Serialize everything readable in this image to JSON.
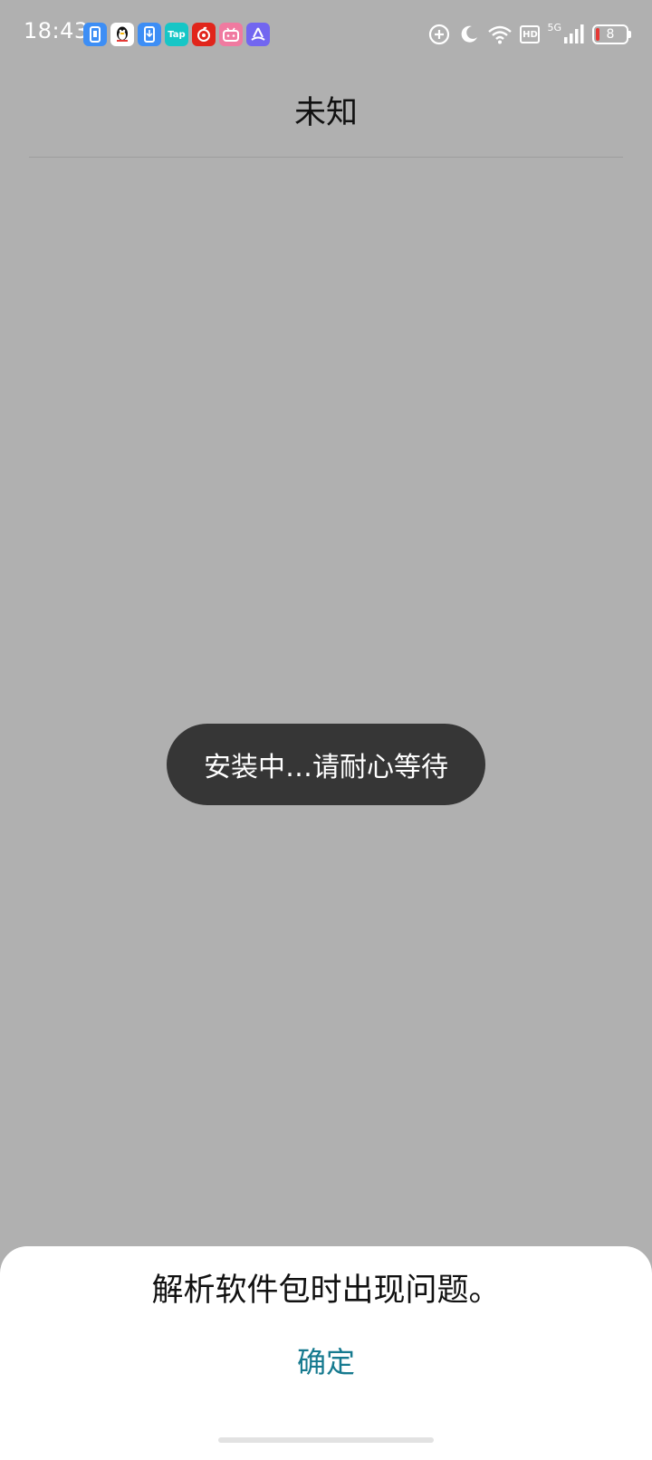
{
  "status_bar": {
    "time": "18:43",
    "notification_icons": [
      {
        "name": "phone-manager-icon",
        "label": "",
        "bg": "#3d8ef5",
        "fg": "#ffffff"
      },
      {
        "name": "qq-penguin-icon",
        "label": "",
        "bg": "#ffffff",
        "fg": "#111111"
      },
      {
        "name": "download-manager-icon",
        "label": "",
        "bg": "#3d8ef5",
        "fg": "#ffffff"
      },
      {
        "name": "taptap-icon",
        "label": "Tap",
        "bg": "#16c6c6",
        "fg": "#ffffff"
      },
      {
        "name": "netease-music-icon",
        "label": "",
        "bg": "#e1251b",
        "fg": "#ffffff"
      },
      {
        "name": "bilibili-icon",
        "label": "",
        "bg": "#f07aa0",
        "fg": "#ffffff"
      },
      {
        "name": "file-transfer-icon",
        "label": "",
        "bg": "#7266f0",
        "fg": "#ffffff"
      }
    ],
    "hd_label": "HD",
    "network_type": "5G",
    "battery_level": "8",
    "battery_color": "#e53935"
  },
  "header": {
    "title": "未知"
  },
  "toast": {
    "text": "安装中…请耐心等待"
  },
  "dialog": {
    "message": "解析软件包时出现问题。",
    "confirm_label": "确定",
    "accent_color": "#167a8f"
  }
}
